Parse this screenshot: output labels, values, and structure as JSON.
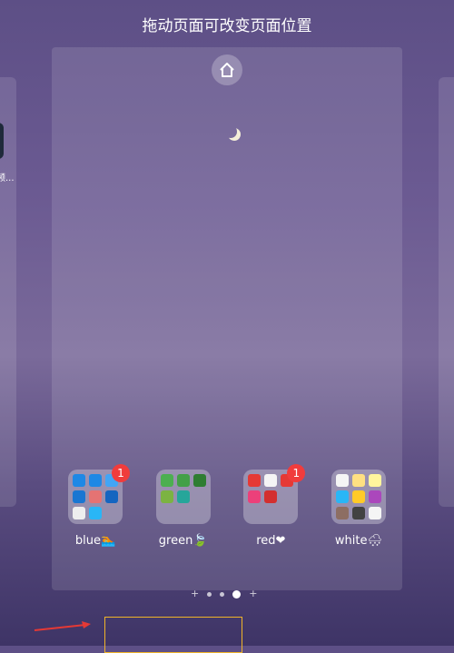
{
  "header": {
    "title": "拖动页面可改变页面位置"
  },
  "left_page": {
    "app_label": "频..."
  },
  "main_page": {
    "home_icon": "home-icon",
    "moon": "crescent-moon",
    "folders": [
      {
        "label": "blue🏊",
        "badge": "1",
        "icons": [
          "#1e88e5",
          "#1e88e5",
          "#42a5f5",
          "#1976d2",
          "#e57373",
          "#1565c0",
          "#eeeeee",
          "#29b6f6"
        ]
      },
      {
        "label": "green🍃",
        "badge": "",
        "icons": [
          "#4caf50",
          "#43a047",
          "#2e7d32",
          "#7cb342",
          "#26a69a"
        ]
      },
      {
        "label": "red❤",
        "badge": "1",
        "icons": [
          "#e53935",
          "#f5f5f5",
          "#e53935",
          "#ec407a",
          "#d32f2f"
        ]
      },
      {
        "label": "white🌨",
        "badge": "",
        "icons": [
          "#f5f5f5",
          "#ffe082",
          "#fff59d",
          "#29b6f6",
          "#ffca28",
          "#ab47bc",
          "#8d6e63",
          "#424242",
          "#f5f5f5"
        ]
      }
    ]
  },
  "page_indicator": {
    "total": 5,
    "current": 4,
    "items": [
      "add",
      "dot",
      "dot",
      "current",
      "add"
    ]
  },
  "colors": {
    "highlight": "#f0b429",
    "arrow": "#e53935",
    "badge": "#f03c3c"
  }
}
